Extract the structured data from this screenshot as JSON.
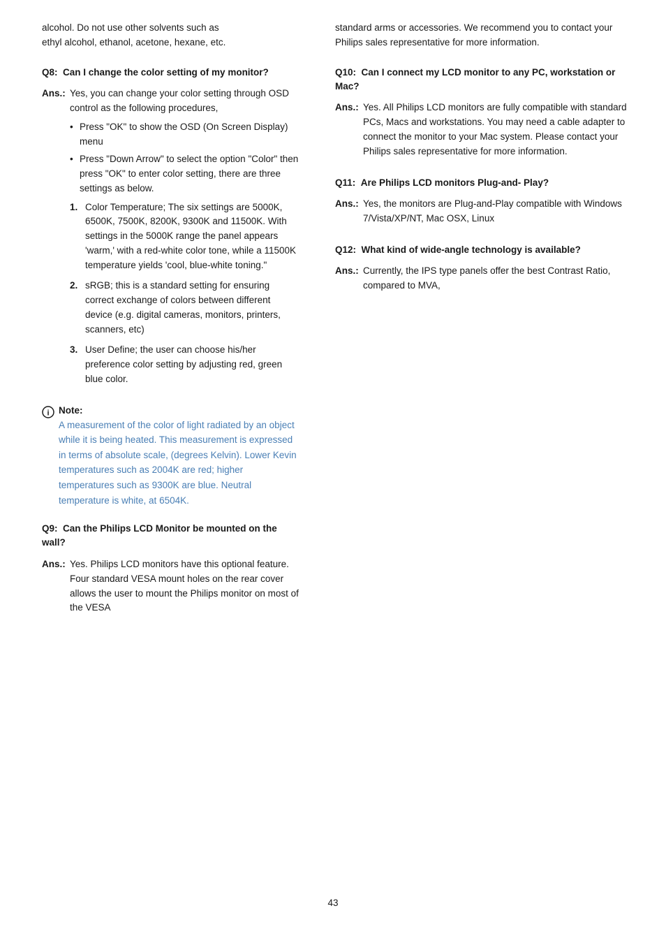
{
  "left_column": {
    "intro": {
      "line1": "alcohol. Do not use other solvents such as",
      "line2": "ethyl alcohol, ethanol, acetone, hexane, etc."
    },
    "q8": {
      "label": "Q8:",
      "text": "Can I change the color setting of my monitor?"
    },
    "a8": {
      "label": "Ans.:",
      "intro": "Yes, you can change your color setting through OSD control as the following procedures,",
      "bullets": [
        "Press \"OK\" to show the OSD (On Screen Display) menu",
        "Press \"Down Arrow\" to select the option \"Color\" then press \"OK\" to enter color setting, there are three settings as below."
      ],
      "numbered": [
        {
          "num": "1.",
          "text": "Color Temperature; The six settings are 5000K, 6500K, 7500K, 8200K, 9300K and 11500K. With settings in the 5000K range the panel appears 'warm,' with a red-white color tone, while a 11500K temperature yields 'cool, blue-white toning.\""
        },
        {
          "num": "2.",
          "text": "sRGB; this is a standard setting for ensuring correct exchange of colors between different device (e.g. digital cameras, monitors, printers, scanners, etc)"
        },
        {
          "num": "3.",
          "text": "User Define; the user can choose his/her preference color setting by adjusting red, green blue color."
        }
      ]
    },
    "note": {
      "title": "Note:",
      "text": "A measurement of the color of light radiated by an object while it is being heated. This measurement is expressed in terms of absolute scale, (degrees Kelvin). Lower Kevin temperatures such as 2004K are red; higher temperatures such as 9300K are blue. Neutral temperature is white, at 6504K."
    },
    "q9": {
      "label": "Q9:",
      "text": "Can the Philips LCD Monitor be  mounted on the wall?"
    },
    "a9": {
      "label": "Ans.:",
      "text": "Yes. Philips LCD monitors have this optional feature. Four standard VESA mount holes on the rear cover allows the user to mount the Philips monitor on most of the VESA"
    }
  },
  "right_column": {
    "intro": {
      "text": "standard arms or accessories. We recommend you to contact your Philips sales representative for more information."
    },
    "q10": {
      "label": "Q10:",
      "text": "Can I connect my LCD monitor to any PC, workstation or Mac?"
    },
    "a10": {
      "label": "Ans.:",
      "text": "Yes. All Philips LCD monitors are fully compatible with standard PCs, Macs and workstations. You may need a cable adapter to connect the monitor to your Mac system. Please contact your Philips sales representative for more information."
    },
    "q11": {
      "label": "Q11:",
      "text": "Are Philips LCD monitors Plug-and- Play?"
    },
    "a11": {
      "label": "Ans.:",
      "text": "Yes, the monitors are Plug-and-Play compatible with Windows 7/Vista/XP/NT, Mac OSX, Linux"
    },
    "q12": {
      "label": "Q12:",
      "text": "What kind of wide-angle technology is available?"
    },
    "a12": {
      "label": "Ans.:",
      "text": "Currently, the IPS type panels offer the best Contrast Ratio, compared to MVA,"
    }
  },
  "page_number": "43",
  "colors": {
    "note_blue": "#4a7fb5",
    "text_dark": "#1a1a1a"
  }
}
